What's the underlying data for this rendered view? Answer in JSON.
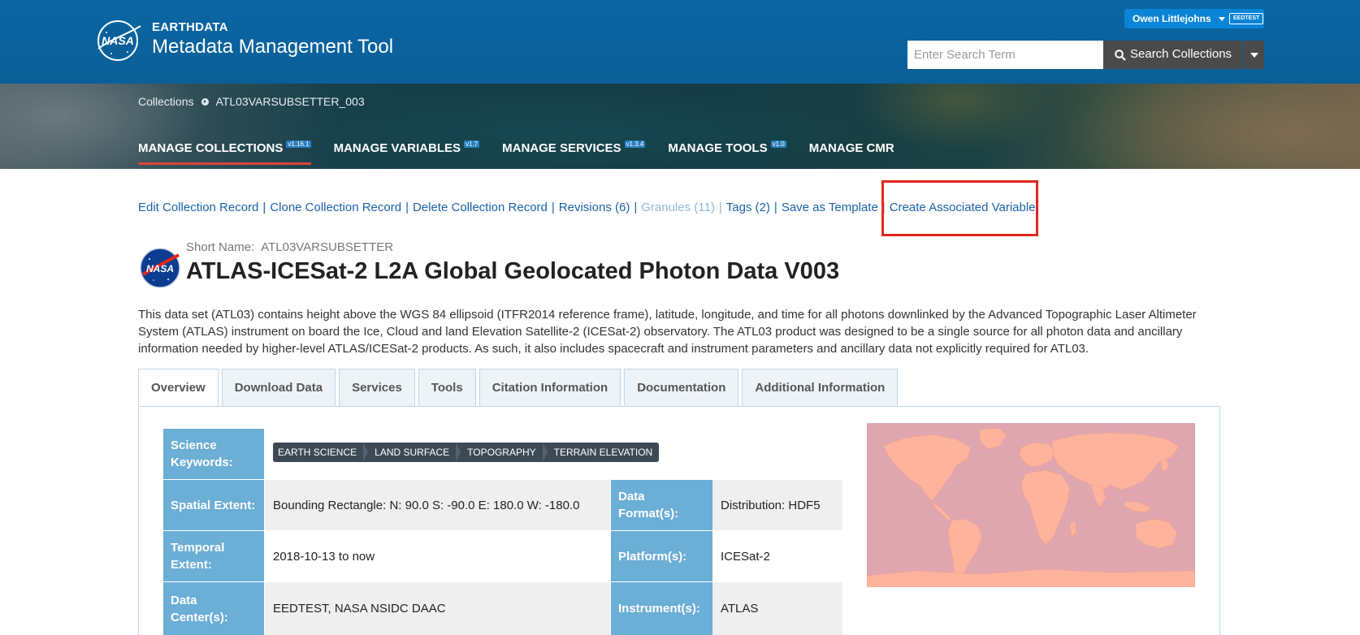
{
  "header": {
    "brand_small": "EARTHDATA",
    "brand_big": "Metadata Management Tool",
    "user_name": "Owen Littlejohns",
    "provider": "EEDTEST",
    "search_placeholder": "Enter Search Term",
    "search_button": "Search Collections"
  },
  "breadcrumb": {
    "root": "Collections",
    "current": "ATL03VARSUBSETTER_003"
  },
  "nav": [
    {
      "label": "MANAGE COLLECTIONS",
      "version": "v1.16.1"
    },
    {
      "label": "MANAGE VARIABLES",
      "version": "v1.7"
    },
    {
      "label": "MANAGE SERVICES",
      "version": "v1.3.4"
    },
    {
      "label": "MANAGE TOOLS",
      "version": "v1.0"
    },
    {
      "label": "MANAGE CMR",
      "version": ""
    }
  ],
  "actions": [
    "Edit Collection Record",
    "Clone Collection Record",
    "Delete Collection Record",
    "Revisions (6)",
    "Granules (11)",
    "Tags (2)",
    "Save as Template",
    "Create Associated Variable"
  ],
  "collection": {
    "short_name_label": "Short Name:",
    "short_name": "ATL03VARSUBSETTER",
    "title": "ATLAS-ICESat-2 L2A Global Geolocated Photon Data V003",
    "description": "This data set (ATL03) contains height above the WGS 84 ellipsoid (ITFR2014 reference frame), latitude, longitude, and time for all photons downlinked by the Advanced Topographic Laser Altimeter System (ATLAS) instrument on board the Ice, Cloud and land Elevation Satellite-2 (ICESat-2) observatory. The ATL03 product was designed to be a single source for all photon data and ancillary information needed by higher-level ATLAS/ICESat-2 products. As such, it also includes spacecraft and instrument parameters and ancillary data not explicitly required for ATL03."
  },
  "tabs": [
    "Overview",
    "Download Data",
    "Services",
    "Tools",
    "Citation Information",
    "Documentation",
    "Additional Information"
  ],
  "overview": {
    "science_keywords_label": "Science Keywords:",
    "science_keywords": [
      "EARTH SCIENCE",
      "LAND SURFACE",
      "TOPOGRAPHY",
      "TERRAIN ELEVATION"
    ],
    "spatial_extent_label": "Spatial Extent:",
    "spatial_extent": "Bounding Rectangle: N: 90.0 S: -90.0 E: 180.0 W: -180.0",
    "data_format_label": "Data Format(s):",
    "data_format": "Distribution: HDF5",
    "temporal_extent_label": "Temporal Extent:",
    "temporal_extent": "2018-10-13 to now",
    "platform_label": "Platform(s):",
    "platform": "ICESat-2",
    "data_center_label": "Data Center(s):",
    "data_center": "EEDTEST, NASA NSIDC DAAC",
    "instrument_label": "Instrument(s):",
    "instrument": "ATLAS"
  },
  "colors": {
    "header_blue": "#0a66a3",
    "link_blue": "#1a63a8",
    "label_blue": "#6baed6",
    "highlight_red": "#e4261f",
    "map_ocean": "#dfa6b0",
    "map_land": "#fdb39c"
  }
}
